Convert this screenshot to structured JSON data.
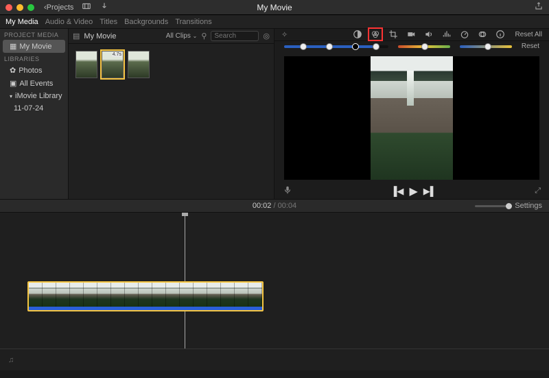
{
  "window": {
    "title": "My Movie"
  },
  "toolbar": {
    "back_label": "Projects"
  },
  "tabs": {
    "items": [
      "My Media",
      "Audio & Video",
      "Titles",
      "Backgrounds",
      "Transitions"
    ],
    "active": 0
  },
  "sidebar": {
    "section1_label": "PROJECT MEDIA",
    "section2_label": "LIBRARIES",
    "project_item": "My Movie",
    "photos": "Photos",
    "all_events": "All Events",
    "library": "iMovie Library",
    "library_date": "11-07-24"
  },
  "media": {
    "header_title": "My Movie",
    "all_clips_label": "All Clips",
    "search_placeholder": "Search",
    "clip_duration": "4.7s"
  },
  "preview": {
    "reset_all_label": "Reset All",
    "reset_label": "Reset"
  },
  "playback": {
    "current": "00:02",
    "total": "00:04",
    "settings_label": "Settings"
  }
}
